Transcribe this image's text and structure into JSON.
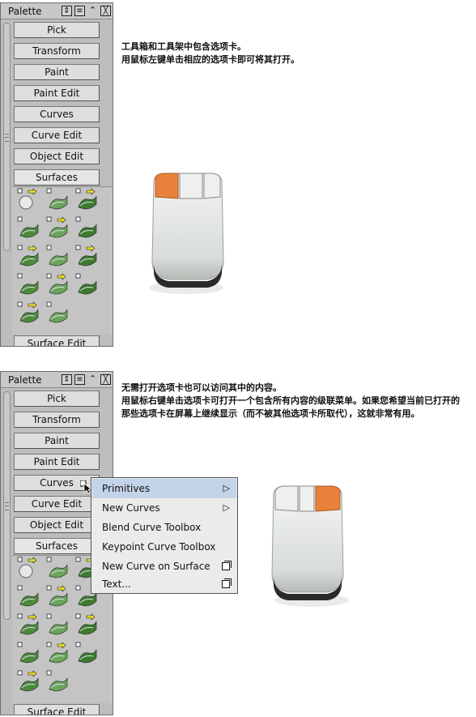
{
  "palette_top": {
    "title": "Palette",
    "tabs": [
      "Pick",
      "Transform",
      "Paint",
      "Paint Edit",
      "Curves",
      "Curve Edit",
      "Object Edit",
      "Surfaces",
      "Surface Edit"
    ]
  },
  "palette_bottom": {
    "title": "Palette",
    "tabs": [
      "Pick",
      "Transform",
      "Paint",
      "Paint Edit",
      "Curves",
      "Curve Edit",
      "Object Edit",
      "Surfaces",
      "Surface Edit"
    ]
  },
  "notes": {
    "top_line1": "工具箱和工具架中包含选项卡。",
    "top_line2": "用鼠标左键单击相应的选项卡即可将其打开。",
    "bottom_line1": "无需打开选项卡也可以访问其中的内容。",
    "bottom_line2": "用鼠标右键单击选项卡可打开一个包含所有内容的级联菜单。如果您希望当前已打开的那些选项卡在屏幕上继续显示（而不被其他选项卡所取代），这就非常有用。"
  },
  "context_menu": {
    "items": [
      {
        "label": "Primitives",
        "suffix": "submenu"
      },
      {
        "label": "New Curves",
        "suffix": "submenu"
      },
      {
        "label": "Blend Curve Toolbox",
        "suffix": "none"
      },
      {
        "label": "Keypoint Curve Toolbox",
        "suffix": "none"
      },
      {
        "label": "New Curve on Surface",
        "suffix": "option-box"
      },
      {
        "label": "Text...",
        "suffix": "option-box"
      }
    ]
  },
  "colors": {
    "mouse_highlight": "#e8823a",
    "menu_highlight": "#c3d3e8",
    "palette_bg": "#bdbdbd"
  }
}
